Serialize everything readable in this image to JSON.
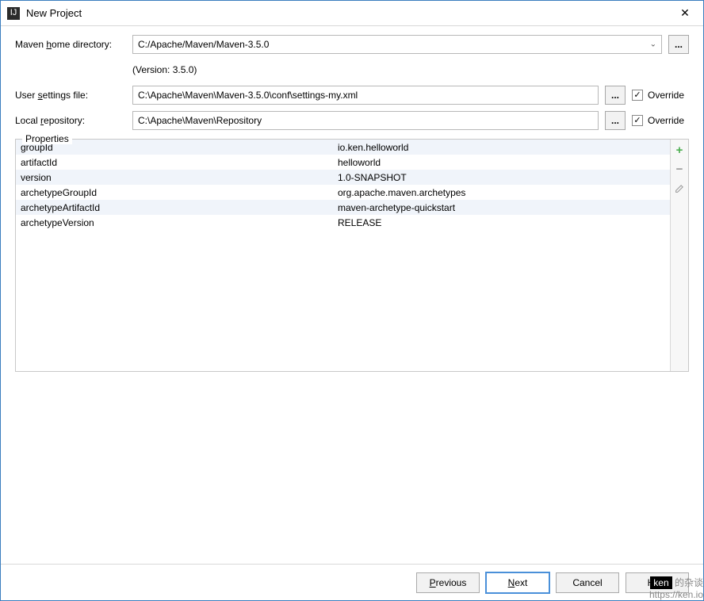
{
  "window": {
    "title": "New Project"
  },
  "labels": {
    "maven_home": "Maven home directory:",
    "user_settings": "User settings file:",
    "local_repo": "Local repository:",
    "properties": "Properties",
    "override": "Override",
    "previous": "Previous",
    "next": "Next",
    "cancel": "Cancel",
    "help": "Help"
  },
  "values": {
    "maven_home": "C:/Apache/Maven/Maven-3.5.0",
    "maven_version": "(Version: 3.5.0)",
    "user_settings": "C:\\Apache\\Maven\\Maven-3.5.0\\conf\\settings-my.xml",
    "local_repo": "C:\\Apache\\Maven\\Repository",
    "override_settings": true,
    "override_repo": true
  },
  "properties": [
    {
      "key": "groupId",
      "value": "io.ken.helloworld"
    },
    {
      "key": "artifactId",
      "value": "helloworld"
    },
    {
      "key": "version",
      "value": "1.0-SNAPSHOT"
    },
    {
      "key": "archetypeGroupId",
      "value": "org.apache.maven.archetypes"
    },
    {
      "key": "archetypeArtifactId",
      "value": "maven-archetype-quickstart"
    },
    {
      "key": "archetypeVersion",
      "value": "RELEASE"
    }
  ],
  "watermark": {
    "brand": "ken",
    "suffix": " 的杂谈",
    "url": "https://ken.io"
  }
}
